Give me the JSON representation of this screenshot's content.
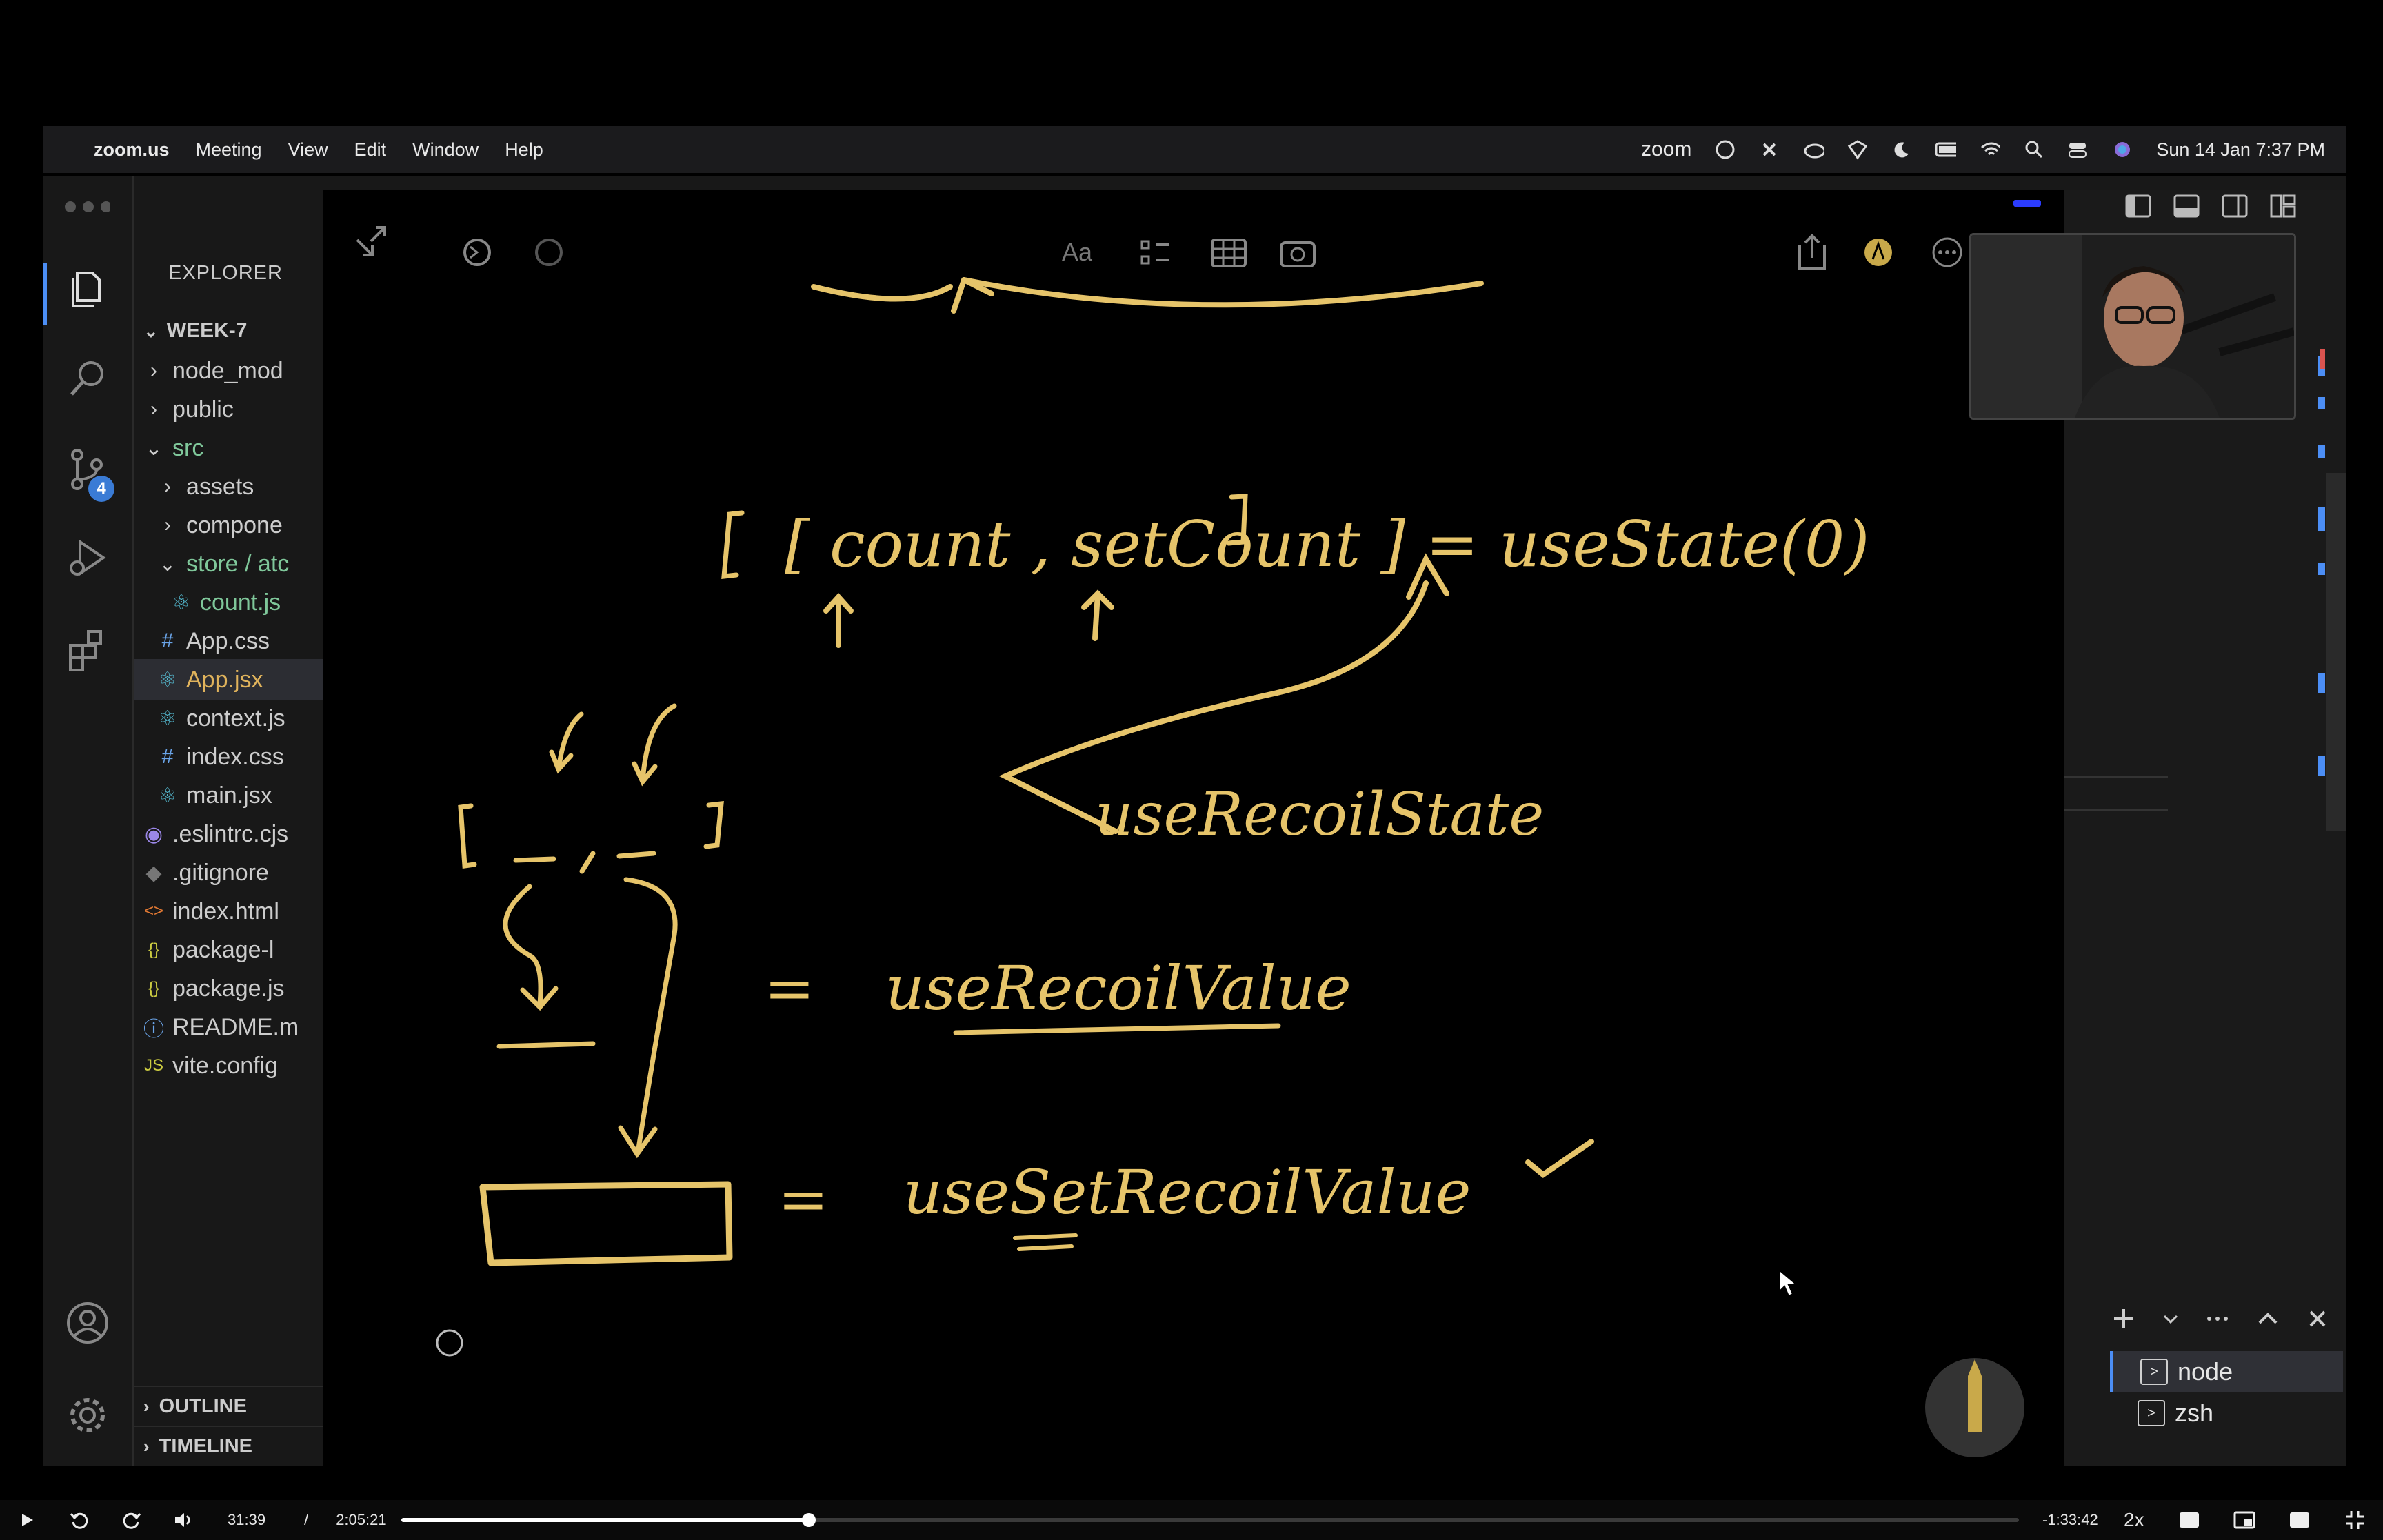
{
  "menubar": {
    "app_name": "zoom.us",
    "menus": [
      "Meeting",
      "View",
      "Edit",
      "Window",
      "Help"
    ],
    "zoom_logo": "zoom",
    "datetime": "Sun 14 Jan  7:37 PM"
  },
  "explorer": {
    "title": "EXPLORER",
    "root": "WEEK-7",
    "items": [
      {
        "label": "node_mod",
        "kind": "folder",
        "indent": 1
      },
      {
        "label": "public",
        "kind": "folder",
        "indent": 1
      },
      {
        "label": "src",
        "kind": "folder-open",
        "indent": 1
      },
      {
        "label": "assets",
        "kind": "folder",
        "indent": 2
      },
      {
        "label": "compone",
        "kind": "folder",
        "indent": 2
      },
      {
        "label": "store / atc",
        "kind": "folder-open",
        "indent": 2
      },
      {
        "label": "count.js",
        "kind": "react",
        "indent": 3
      },
      {
        "label": "App.css",
        "kind": "css",
        "indent": 2
      },
      {
        "label": "App.jsx",
        "kind": "react",
        "indent": 2,
        "active": true
      },
      {
        "label": "context.js",
        "kind": "react",
        "indent": 2
      },
      {
        "label": "index.css",
        "kind": "css",
        "indent": 2
      },
      {
        "label": "main.jsx",
        "kind": "react",
        "indent": 2
      },
      {
        "label": ".eslintrc.cjs",
        "kind": "eslint",
        "indent": 1
      },
      {
        "label": ".gitignore",
        "kind": "git",
        "indent": 1
      },
      {
        "label": "index.html",
        "kind": "html",
        "indent": 1
      },
      {
        "label": "package-l",
        "kind": "json",
        "indent": 1
      },
      {
        "label": "package.js",
        "kind": "json",
        "indent": 1
      },
      {
        "label": "README.m",
        "kind": "info",
        "indent": 1
      },
      {
        "label": "vite.config",
        "kind": "js",
        "indent": 1
      }
    ],
    "outline": "OUTLINE",
    "timeline": "TIMELINE",
    "scm_badge": "4"
  },
  "board": {
    "toolbar_text": "Aa",
    "line1": "[ count , setCount ] = useState(0)",
    "line2": "useRecoilState",
    "line3": "useRecoilValue",
    "line4": "useSetRecoilValue",
    "equals": "="
  },
  "terminal": {
    "items": [
      "node",
      "zsh"
    ]
  },
  "player": {
    "current_time": "31:39",
    "separator": "/",
    "total_time": "2:05:21",
    "remaining": "-1:33:42",
    "speed": "2x",
    "progress": 0.252
  },
  "colors": {
    "ink": "#e6c46a",
    "accent_blue": "#4c8ef5",
    "folder_green": "#7fc79a"
  }
}
